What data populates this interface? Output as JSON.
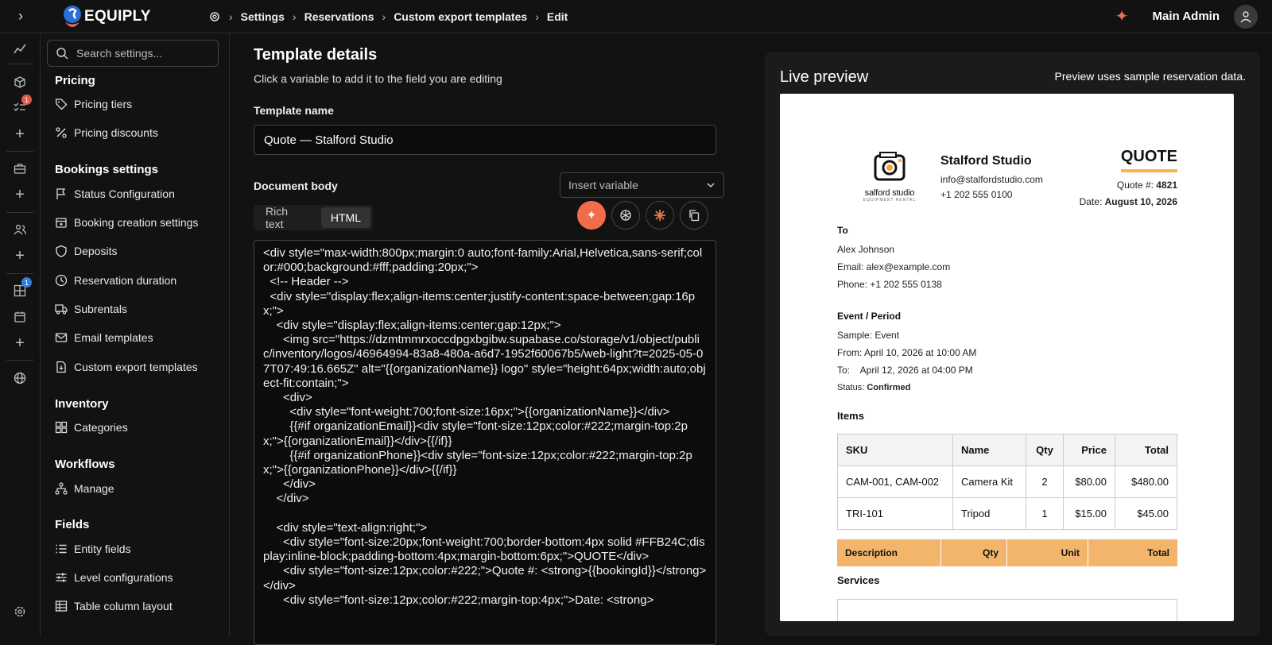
{
  "topbar": {
    "brand": "EQUIPLY",
    "breadcrumb": [
      "Settings",
      "Reservations",
      "Custom export templates",
      "Edit"
    ],
    "user": "Main Admin"
  },
  "rail": {
    "badges": [
      "1",
      "1"
    ]
  },
  "sidebar": {
    "search_placeholder": "Search settings...",
    "sections": [
      {
        "title": "Pricing",
        "items": [
          {
            "label": "Pricing tiers",
            "icon": "tag-icon"
          },
          {
            "label": "Pricing discounts",
            "icon": "percent-icon"
          }
        ]
      },
      {
        "title": "Bookings settings",
        "items": [
          {
            "label": "Status Configuration",
            "icon": "flag-icon"
          },
          {
            "label": "Booking creation settings",
            "icon": "calendar-plus-icon"
          },
          {
            "label": "Deposits",
            "icon": "shield-icon"
          },
          {
            "label": "Reservation duration",
            "icon": "clock-icon"
          },
          {
            "label": "Subrentals",
            "icon": "truck-icon"
          },
          {
            "label": "Email templates",
            "icon": "mail-icon"
          },
          {
            "label": "Custom export templates",
            "icon": "file-export-icon"
          }
        ]
      },
      {
        "title": "Inventory",
        "items": [
          {
            "label": "Categories",
            "icon": "grid-icon"
          }
        ]
      },
      {
        "title": "Workflows",
        "items": [
          {
            "label": "Manage",
            "icon": "workflow-icon"
          }
        ]
      },
      {
        "title": "Fields",
        "items": [
          {
            "label": "Entity fields",
            "icon": "list-icon"
          },
          {
            "label": "Level configurations",
            "icon": "sliders-icon"
          },
          {
            "label": "Table column layout",
            "icon": "table-icon"
          }
        ]
      }
    ]
  },
  "editor": {
    "title": "Template details",
    "subtitle": "Click a variable to add it to the field you are editing",
    "name_label": "Template name",
    "name_value": "Quote — Stalford Studio",
    "body_label": "Document body",
    "insert_placeholder": "Insert variable",
    "tabs": [
      "Rich text",
      "HTML"
    ],
    "code": "<div style=\"max-width:800px;margin:0 auto;font-family:Arial,Helvetica,sans-serif;color:#000;background:#fff;padding:20px;\">\n  <!-- Header -->\n  <div style=\"display:flex;align-items:center;justify-content:space-between;gap:16px;\">\n    <div style=\"display:flex;align-items:center;gap:12px;\">\n      <img src=\"https://dzmtmmrxoccdpgxbgibw.supabase.co/storage/v1/object/public/inventory/logos/46964994-83a8-480a-a6d7-1952f60067b5/web-light?t=2025-05-07T07:49:16.665Z\" alt=\"{{organizationName}} logo\" style=\"height:64px;width:auto;object-fit:contain;\">\n      <div>\n        <div style=\"font-weight:700;font-size:16px;\">{{organizationName}}</div>\n        {{#if organizationEmail}}<div style=\"font-size:12px;color:#222;margin-top:2px;\">{{organizationEmail}}</div>{{/if}}\n        {{#if organizationPhone}}<div style=\"font-size:12px;color:#222;margin-top:2px;\">{{organizationPhone}}</div>{{/if}}\n      </div>\n    </div>\n\n    <div style=\"text-align:right;\">\n      <div style=\"font-size:20px;font-weight:700;border-bottom:4px solid #FFB24C;display:inline-block;padding-bottom:4px;margin-bottom:6px;\">QUOTE</div>\n      <div style=\"font-size:12px;color:#222;\">Quote #: <strong>{{bookingId}}</strong></div>\n      <div style=\"font-size:12px;color:#222;margin-top:4px;\">Date: <strong>"
  },
  "preview": {
    "title": "Live preview",
    "note": "Preview uses sample reservation data.",
    "org_name": "Stalford Studio",
    "org_email": "info@stalfordstudio.com",
    "org_phone": "+1 202 555 0100",
    "logo_text": "salford studio",
    "logo_sub": "EQUIPMENT RENTAL",
    "quote_title": "QUOTE",
    "quote_no_label": "Quote #:",
    "quote_no": "4821",
    "date_label": "Date:",
    "date": "August 10, 2026",
    "to_title": "To",
    "to_name": "Alex Johnson",
    "to_email": "Email: alex@example.com",
    "to_phone": "Phone: +1 202 555 0138",
    "event_title": "Event / Period",
    "event_name": "Sample: Event",
    "from": "From: April 10, 2026 at 10:00 AM",
    "to_date": "To:    April 12, 2026 at 04:00 PM",
    "status_label": "Status:",
    "status": "Confirmed",
    "items_title": "Items",
    "items_cols": [
      "SKU",
      "Name",
      "Qty",
      "Price",
      "Total"
    ],
    "items_rows": [
      [
        "CAM-001, CAM-002",
        "Camera Kit",
        "2",
        "$80.00",
        "$480.00"
      ],
      [
        "TRI-101",
        "Tripod",
        "1",
        "$15.00",
        "$45.00"
      ]
    ],
    "svc_cols": [
      "Description",
      "Qty",
      "Unit",
      "Total"
    ],
    "services_title": "Services"
  }
}
